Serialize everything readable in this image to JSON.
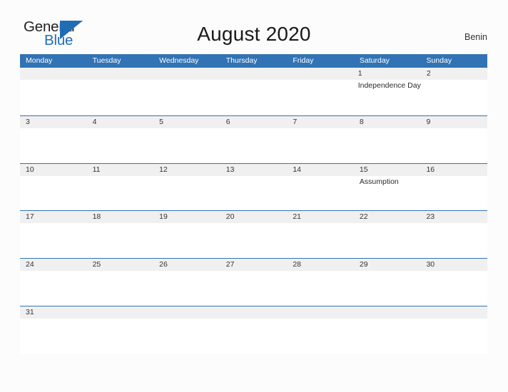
{
  "brand": {
    "name_part1": "General",
    "name_part2": "Blue",
    "flag_icon": "triangle-flag-icon",
    "accent_color": "#1f6db5"
  },
  "header": {
    "title": "August 2020",
    "country": "Benin"
  },
  "theme": {
    "header_blue": "#3173b4",
    "band_gray": "#f0f0f0",
    "page_background": "#fcfcfd",
    "text_color": "#333333"
  },
  "calendar": {
    "month": "August",
    "year": "2020",
    "weekday_headers": [
      "Monday",
      "Tuesday",
      "Wednesday",
      "Thursday",
      "Friday",
      "Saturday",
      "Sunday"
    ],
    "weeks": [
      [
        {
          "day": "",
          "events": []
        },
        {
          "day": "",
          "events": []
        },
        {
          "day": "",
          "events": []
        },
        {
          "day": "",
          "events": []
        },
        {
          "day": "",
          "events": []
        },
        {
          "day": "1",
          "events": [
            "Independence Day"
          ]
        },
        {
          "day": "2",
          "events": []
        }
      ],
      [
        {
          "day": "3",
          "events": []
        },
        {
          "day": "4",
          "events": []
        },
        {
          "day": "5",
          "events": []
        },
        {
          "day": "6",
          "events": []
        },
        {
          "day": "7",
          "events": []
        },
        {
          "day": "8",
          "events": []
        },
        {
          "day": "9",
          "events": []
        }
      ],
      [
        {
          "day": "10",
          "events": []
        },
        {
          "day": "11",
          "events": []
        },
        {
          "day": "12",
          "events": []
        },
        {
          "day": "13",
          "events": []
        },
        {
          "day": "14",
          "events": []
        },
        {
          "day": "15",
          "events": [
            "Assumption"
          ]
        },
        {
          "day": "16",
          "events": []
        }
      ],
      [
        {
          "day": "17",
          "events": []
        },
        {
          "day": "18",
          "events": []
        },
        {
          "day": "19",
          "events": []
        },
        {
          "day": "20",
          "events": []
        },
        {
          "day": "21",
          "events": []
        },
        {
          "day": "22",
          "events": []
        },
        {
          "day": "23",
          "events": []
        }
      ],
      [
        {
          "day": "24",
          "events": []
        },
        {
          "day": "25",
          "events": []
        },
        {
          "day": "26",
          "events": []
        },
        {
          "day": "27",
          "events": []
        },
        {
          "day": "28",
          "events": []
        },
        {
          "day": "29",
          "events": []
        },
        {
          "day": "30",
          "events": []
        }
      ],
      [
        {
          "day": "31",
          "events": []
        },
        {
          "day": "",
          "events": []
        },
        {
          "day": "",
          "events": []
        },
        {
          "day": "",
          "events": []
        },
        {
          "day": "",
          "events": []
        },
        {
          "day": "",
          "events": []
        },
        {
          "day": "",
          "events": []
        }
      ]
    ]
  }
}
